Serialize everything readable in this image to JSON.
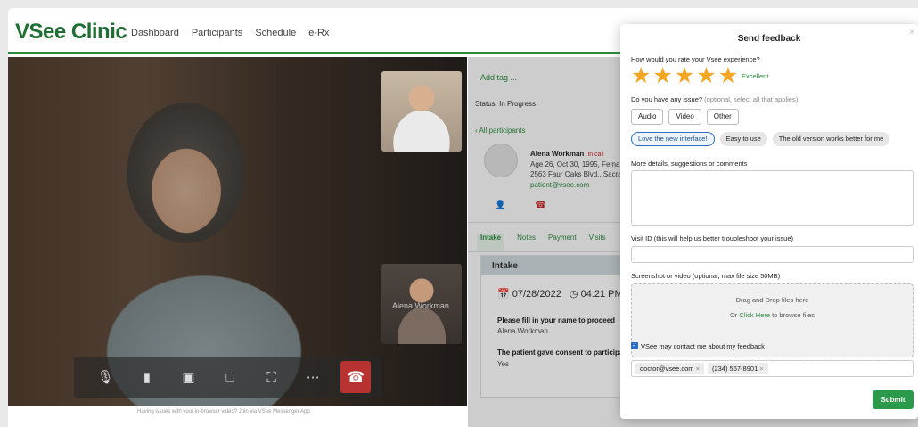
{
  "app": {
    "logo": "VSee Clinic",
    "nav": [
      "Dashboard",
      "Participants",
      "Schedule",
      "e-Rx"
    ]
  },
  "video": {
    "self_name": "Alena Workman",
    "note": "Having issues with your in-browser video? Join via VSee Messenger App",
    "controls": [
      "microphone-icon",
      "camera-icon",
      "screen-share-icon",
      "chat-icon",
      "fullscreen-icon",
      "more-icon",
      "end-call-icon"
    ]
  },
  "panel": {
    "add_tag": "Add tag ...",
    "status": "Status: In Progress",
    "back": "All participants",
    "patient": {
      "name": "Alena Workman",
      "badge": "In call",
      "line1": "Age 26, Oct 30, 1995, Fema",
      "line2": "2563 Faur Oaks Blvd., Sacra",
      "email": "patient@vsee.com"
    },
    "tabs": [
      "Intake",
      "Notes",
      "Payment",
      "Visits"
    ],
    "intake": {
      "header": "Intake",
      "date": "07/28/2022",
      "time": "04:21 PM",
      "q1": "Please fill in your name to proceed",
      "a1": "Alena Workman",
      "q2": "The patient gave consent to participate",
      "a2": "Yes"
    }
  },
  "feedback": {
    "title": "Send feedback",
    "close": "×",
    "rate_question": "How would you rate your Vsee experience?",
    "rating": 5,
    "rating_label": "Excellent",
    "issue_question": "Do you have any issue?",
    "issue_optional": "(optional, select all that applies)",
    "issue_buttons": [
      "Audio",
      "Video",
      "Other"
    ],
    "pills": [
      "Love the new interface!",
      "Easy to use",
      "The old version works better for me"
    ],
    "details_label": "More details, suggestions or comments",
    "details_value": "",
    "visit_id_label": "Visit ID (this will help us better troubleshoot your issue)",
    "visit_id_value": "",
    "screenshot_label": "Screenshot or video (optional, max file size 50MB)",
    "drop_text": "Drag and Drop files here",
    "drop_or": "Or",
    "drop_link": "Click Here",
    "drop_suffix": "to browse files",
    "contact_label": "VSee may contact me about my feedback",
    "contact_checked": true,
    "contacts": [
      "doctor@vsee.com",
      "(234) 567-8901"
    ],
    "submit": "Submit"
  },
  "colors": {
    "brand": "#1f6f35",
    "accent": "#2b9a4a",
    "star": "#f5a623",
    "selected": "#2b6cc4",
    "danger": "#b83232"
  }
}
